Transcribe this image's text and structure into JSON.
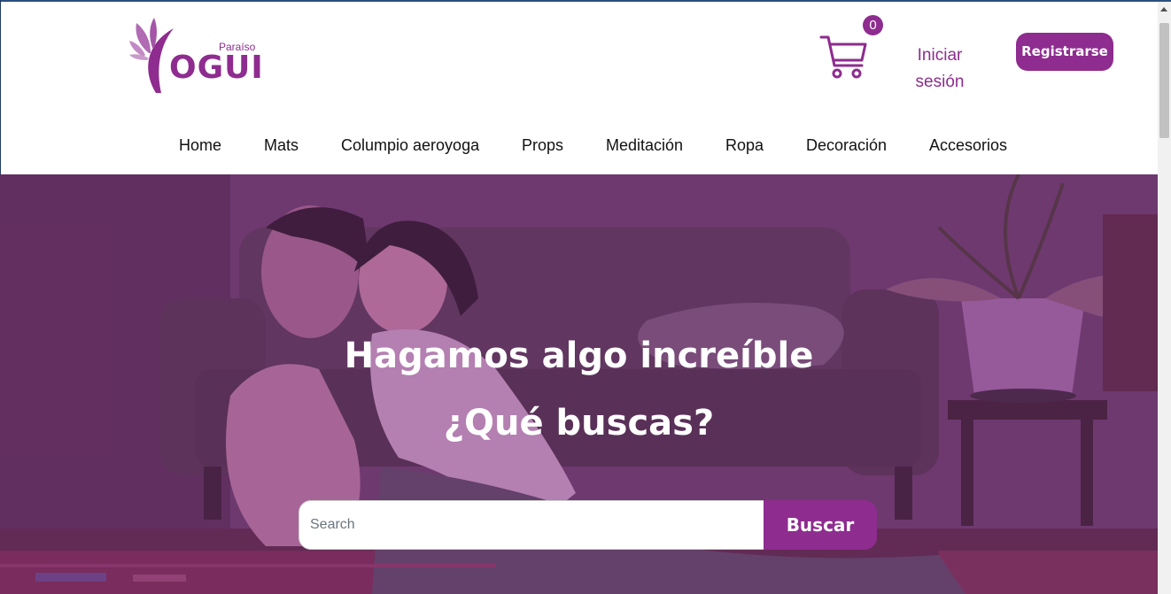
{
  "brand": {
    "small": "Paraíso",
    "name": "OGUI",
    "color": "#8e2c8f"
  },
  "header": {
    "cart_count": "0",
    "login_label": "Iniciar sesión",
    "register_label": "Registrarse"
  },
  "nav": {
    "items": [
      {
        "label": "Home"
      },
      {
        "label": "Mats"
      },
      {
        "label": "Columpio aeroyoga"
      },
      {
        "label": "Props"
      },
      {
        "label": "Meditación"
      },
      {
        "label": "Ropa"
      },
      {
        "label": "Decoración"
      },
      {
        "label": "Accesorios"
      }
    ]
  },
  "hero": {
    "title": "Hagamos algo increíble",
    "subtitle": "¿Qué buscas?",
    "search_placeholder": "Search",
    "search_button": "Buscar"
  }
}
